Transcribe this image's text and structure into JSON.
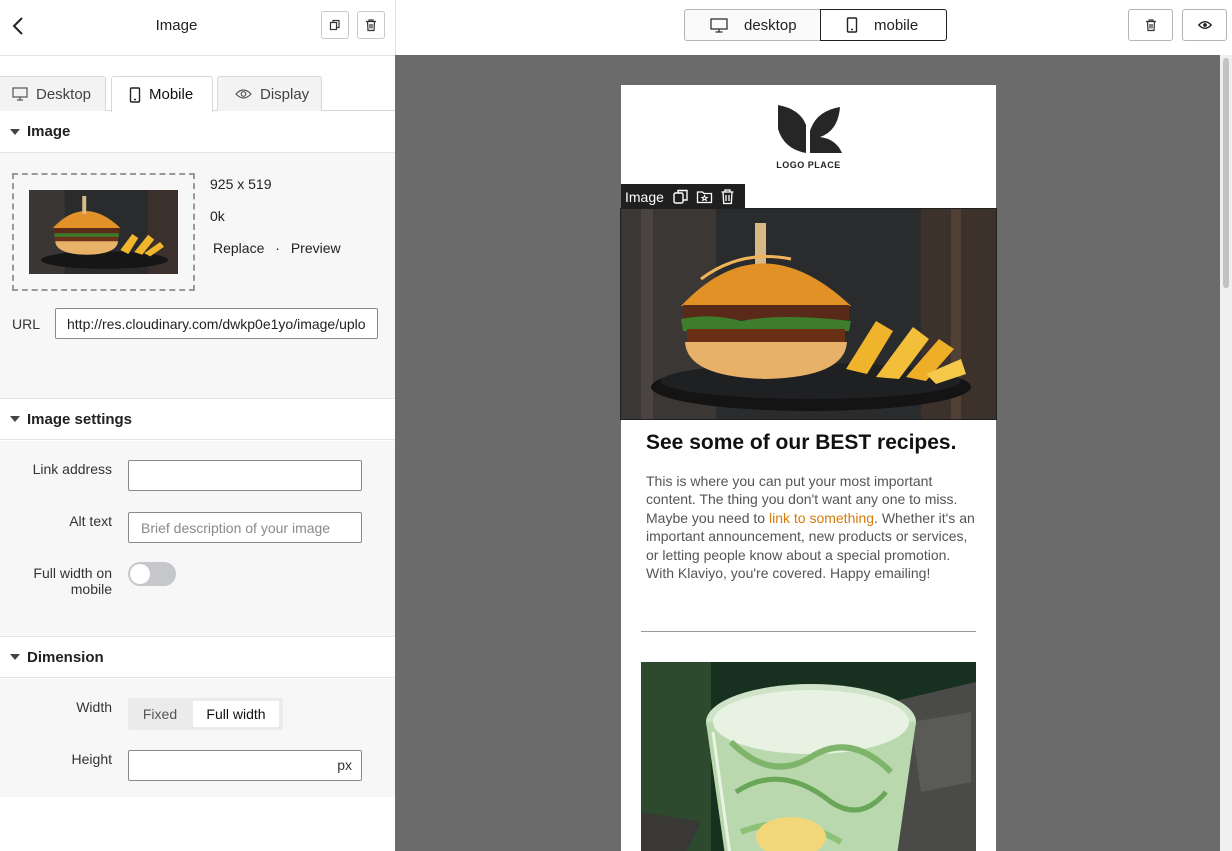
{
  "panel": {
    "title": "Image",
    "tabs": [
      {
        "label": "Desktop",
        "icon": "monitor-icon"
      },
      {
        "label": "Mobile",
        "icon": "phone-icon"
      },
      {
        "label": "Display",
        "icon": "eye-icon"
      }
    ],
    "active_tab": "Mobile",
    "image_section": {
      "title": "Image",
      "dimensions": "925 x 519",
      "size": "0k",
      "replace_label": "Replace",
      "separator": "·",
      "preview_label": "Preview",
      "url_label": "URL",
      "url_value": "http://res.cloudinary.com/dwkp0e1yo/image/upload/"
    },
    "settings_section": {
      "title": "Image settings",
      "link_label": "Link address",
      "link_value": "",
      "alt_label": "Alt text",
      "alt_placeholder": "Brief description of your image",
      "full_width_label": "Full width on mobile",
      "full_width_on": false
    },
    "dimension_section": {
      "title": "Dimension",
      "width_label": "Width",
      "width_options": [
        "Fixed",
        "Full width"
      ],
      "width_selected": "Full width",
      "height_label": "Height",
      "height_value": "",
      "height_unit": "px"
    }
  },
  "toolbar": {
    "desktop_label": "desktop",
    "mobile_label": "mobile",
    "active_device": "mobile"
  },
  "email": {
    "logo_text": "LOGO PLACE",
    "selected_block_label": "Image",
    "heading": "See some of our BEST recipes.",
    "body_before_link": "This is where you can put your most important content. The thing you don't want any one to miss. Maybe you need to ",
    "body_link": "link to something",
    "body_after_link": ". Whether it's an important announcement, new products or services, or letting people know about a special promotion. With Klaviyo, you're covered. Happy emailing!"
  },
  "colors": {
    "canvas_bg": "#6b6b6b",
    "link": "#d57b0b",
    "toolbar_dark": "#1f1f1f",
    "toggle_off": "#c6c7cb"
  }
}
